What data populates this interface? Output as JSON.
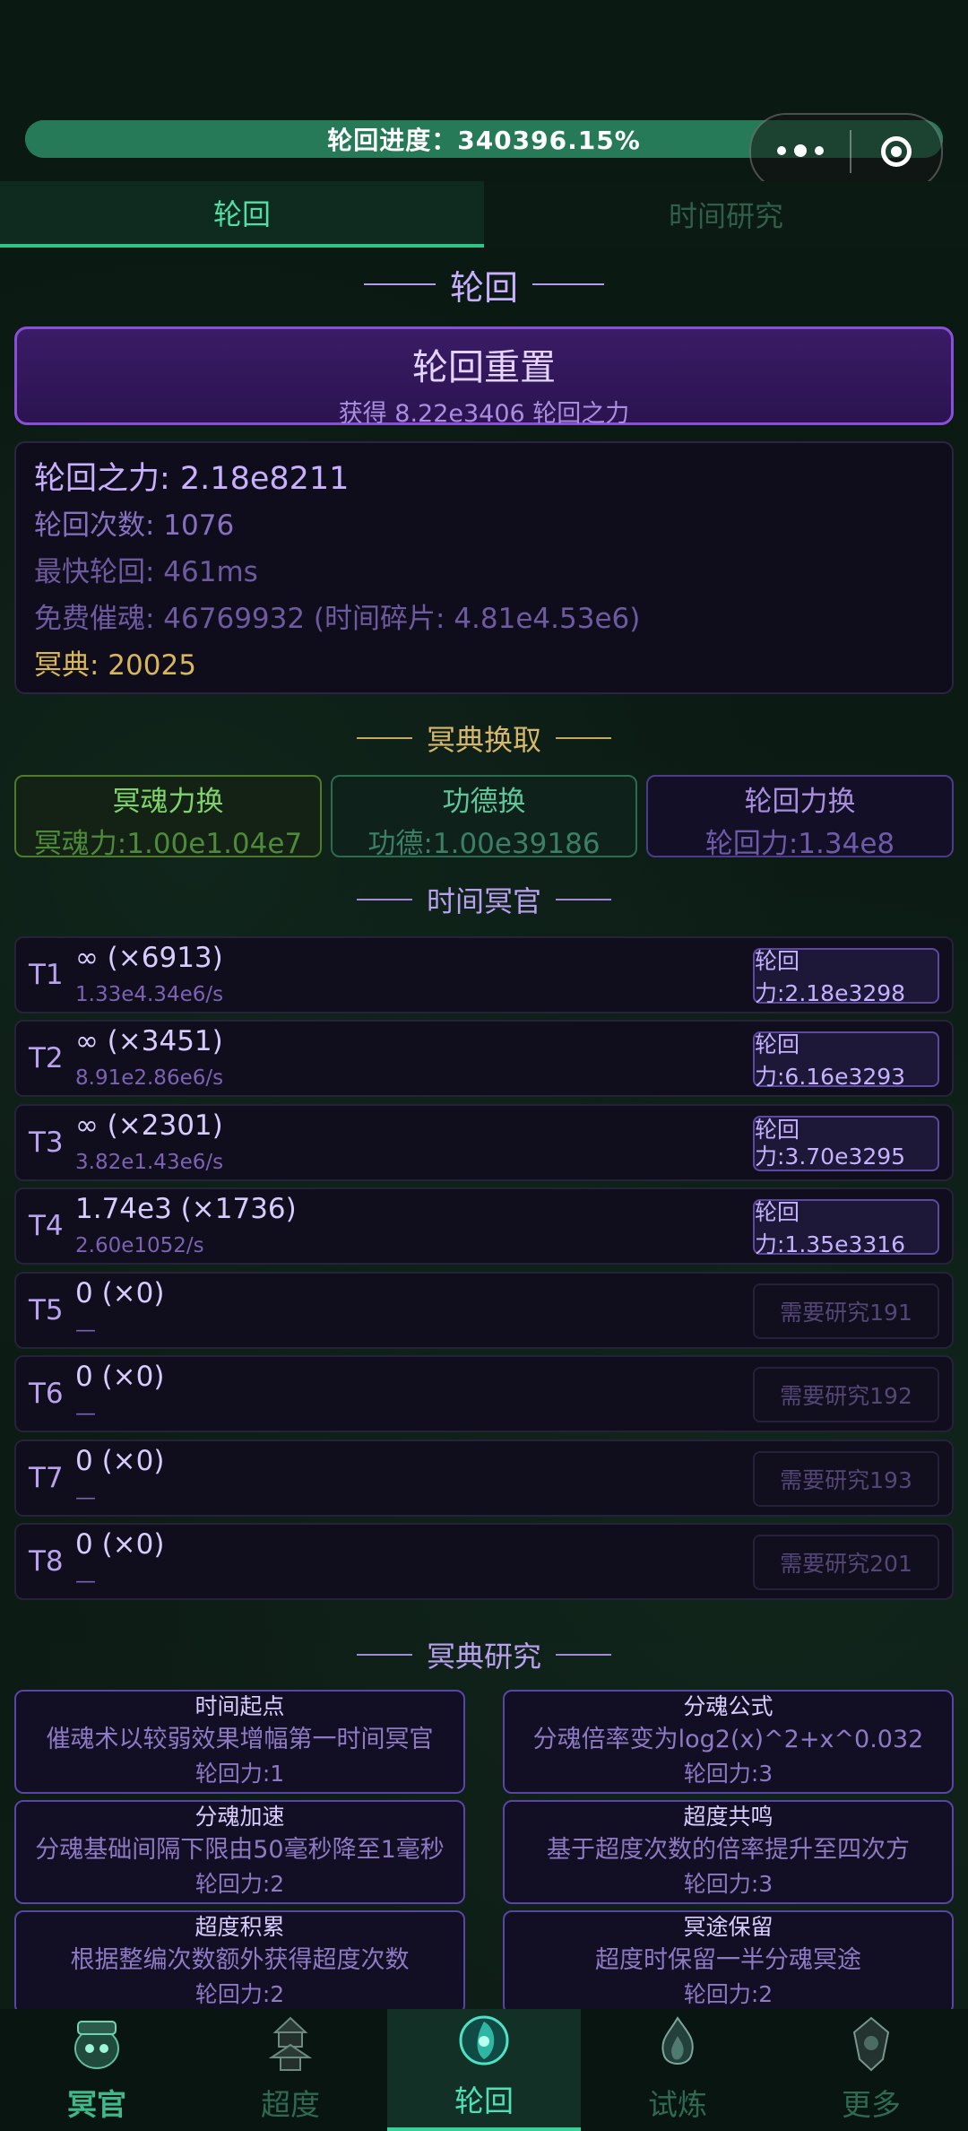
{
  "progress": {
    "label": "轮回进度：340396.15%",
    "fill_fraction": 1.0
  },
  "tabs": [
    {
      "label": "轮回",
      "active": true
    },
    {
      "label": "时间研究",
      "active": false
    }
  ],
  "section_lunhui": "轮回",
  "reset": {
    "title": "轮回重置",
    "subtitle": "获得 8.22e3406 轮回之力"
  },
  "stats": {
    "power": "轮回之力: 2.18e8211",
    "count": "轮回次数: 1076",
    "fastest": "最快轮回: 461ms",
    "free_soul": "免费催魂: 46769932 (时间碎片: 4.81e4.53e6)",
    "mingdian": "冥典: 20025"
  },
  "section_exchange": "冥典换取",
  "exchange": [
    {
      "title": "冥魂力换",
      "cost": "冥魂力:1.00e1.04e7",
      "color": "#7ed36a"
    },
    {
      "title": "功德换",
      "cost": "功德:1.00e39186",
      "color": "#5fc79a"
    },
    {
      "title": "轮回力换",
      "cost": "轮回力:1.34e8",
      "color": "#a98ee0"
    }
  ],
  "section_time": "时间冥官",
  "time_rows": [
    {
      "label": "T1",
      "amount": "∞ (×6913)",
      "rate": "1.33e4.34e6/s",
      "button": "轮回力:2.18e3298",
      "enabled": true
    },
    {
      "label": "T2",
      "amount": "∞ (×3451)",
      "rate": "8.91e2.86e6/s",
      "button": "轮回力:6.16e3293",
      "enabled": true
    },
    {
      "label": "T3",
      "amount": "∞ (×2301)",
      "rate": "3.82e1.43e6/s",
      "button": "轮回力:3.70e3295",
      "enabled": true
    },
    {
      "label": "T4",
      "amount": "1.74e3 (×1736)",
      "rate": "2.60e1052/s",
      "button": "轮回力:1.35e3316",
      "enabled": true
    },
    {
      "label": "T5",
      "amount": "0 (×0)",
      "rate": "—",
      "button": "需要研究191",
      "enabled": false
    },
    {
      "label": "T6",
      "amount": "0 (×0)",
      "rate": "—",
      "button": "需要研究192",
      "enabled": false
    },
    {
      "label": "T7",
      "amount": "0 (×0)",
      "rate": "—",
      "button": "需要研究193",
      "enabled": false
    },
    {
      "label": "T8",
      "amount": "0 (×0)",
      "rate": "—",
      "button": "需要研究201",
      "enabled": false
    }
  ],
  "section_research": "冥典研究",
  "research": [
    {
      "name": "时间起点",
      "desc": "催魂术以较弱效果增幅第一时间冥官",
      "cost": "轮回力:1"
    },
    {
      "name": "分魂公式",
      "desc": "分魂倍率变为log2(x)^2+x^0.032",
      "cost": "轮回力:3"
    },
    {
      "name": "分魂加速",
      "desc": "分魂基础间隔下限由50毫秒降至1毫秒",
      "cost": "轮回力:2"
    },
    {
      "name": "超度共鸣",
      "desc": "基于超度次数的倍率提升至四次方",
      "cost": "轮回力:3"
    },
    {
      "name": "超度积累",
      "desc": "根据整编次数额外获得超度次数",
      "cost": "轮回力:2"
    },
    {
      "name": "冥途保留",
      "desc": "超度时保留一半分魂冥途",
      "cost": "轮回力:2"
    }
  ],
  "nav": [
    {
      "label": "冥官",
      "icon": "ghost-official-icon",
      "color": "#3fb88a",
      "active": false
    },
    {
      "label": "超度",
      "icon": "pagoda-icon",
      "color": "#2e6a52",
      "active": false
    },
    {
      "label": "轮回",
      "icon": "reincarnation-icon",
      "color": "#4fe0b6",
      "active": true
    },
    {
      "label": "试炼",
      "icon": "trial-flame-icon",
      "color": "#2e6a52",
      "active": false
    },
    {
      "label": "更多",
      "icon": "more-emblem-icon",
      "color": "#2e6a52",
      "active": false
    }
  ]
}
